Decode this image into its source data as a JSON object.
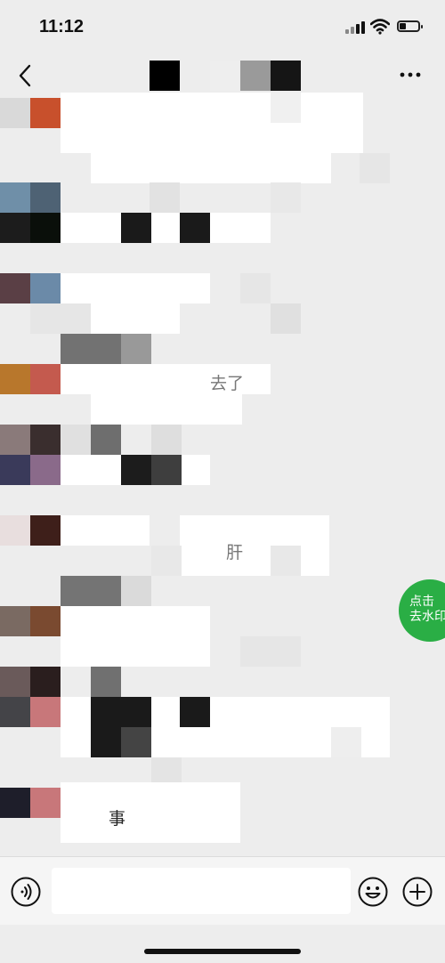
{
  "status_bar": {
    "time": "11:12",
    "battery_level": 0.35
  },
  "chat": {
    "texts": [
      "去了",
      "肝",
      "事"
    ]
  },
  "watermark_button": {
    "line1": "点击",
    "line2": "去水印"
  },
  "colors": {
    "accent": "#2aae45",
    "background": "#ededed",
    "bubble": "#ffffff"
  }
}
